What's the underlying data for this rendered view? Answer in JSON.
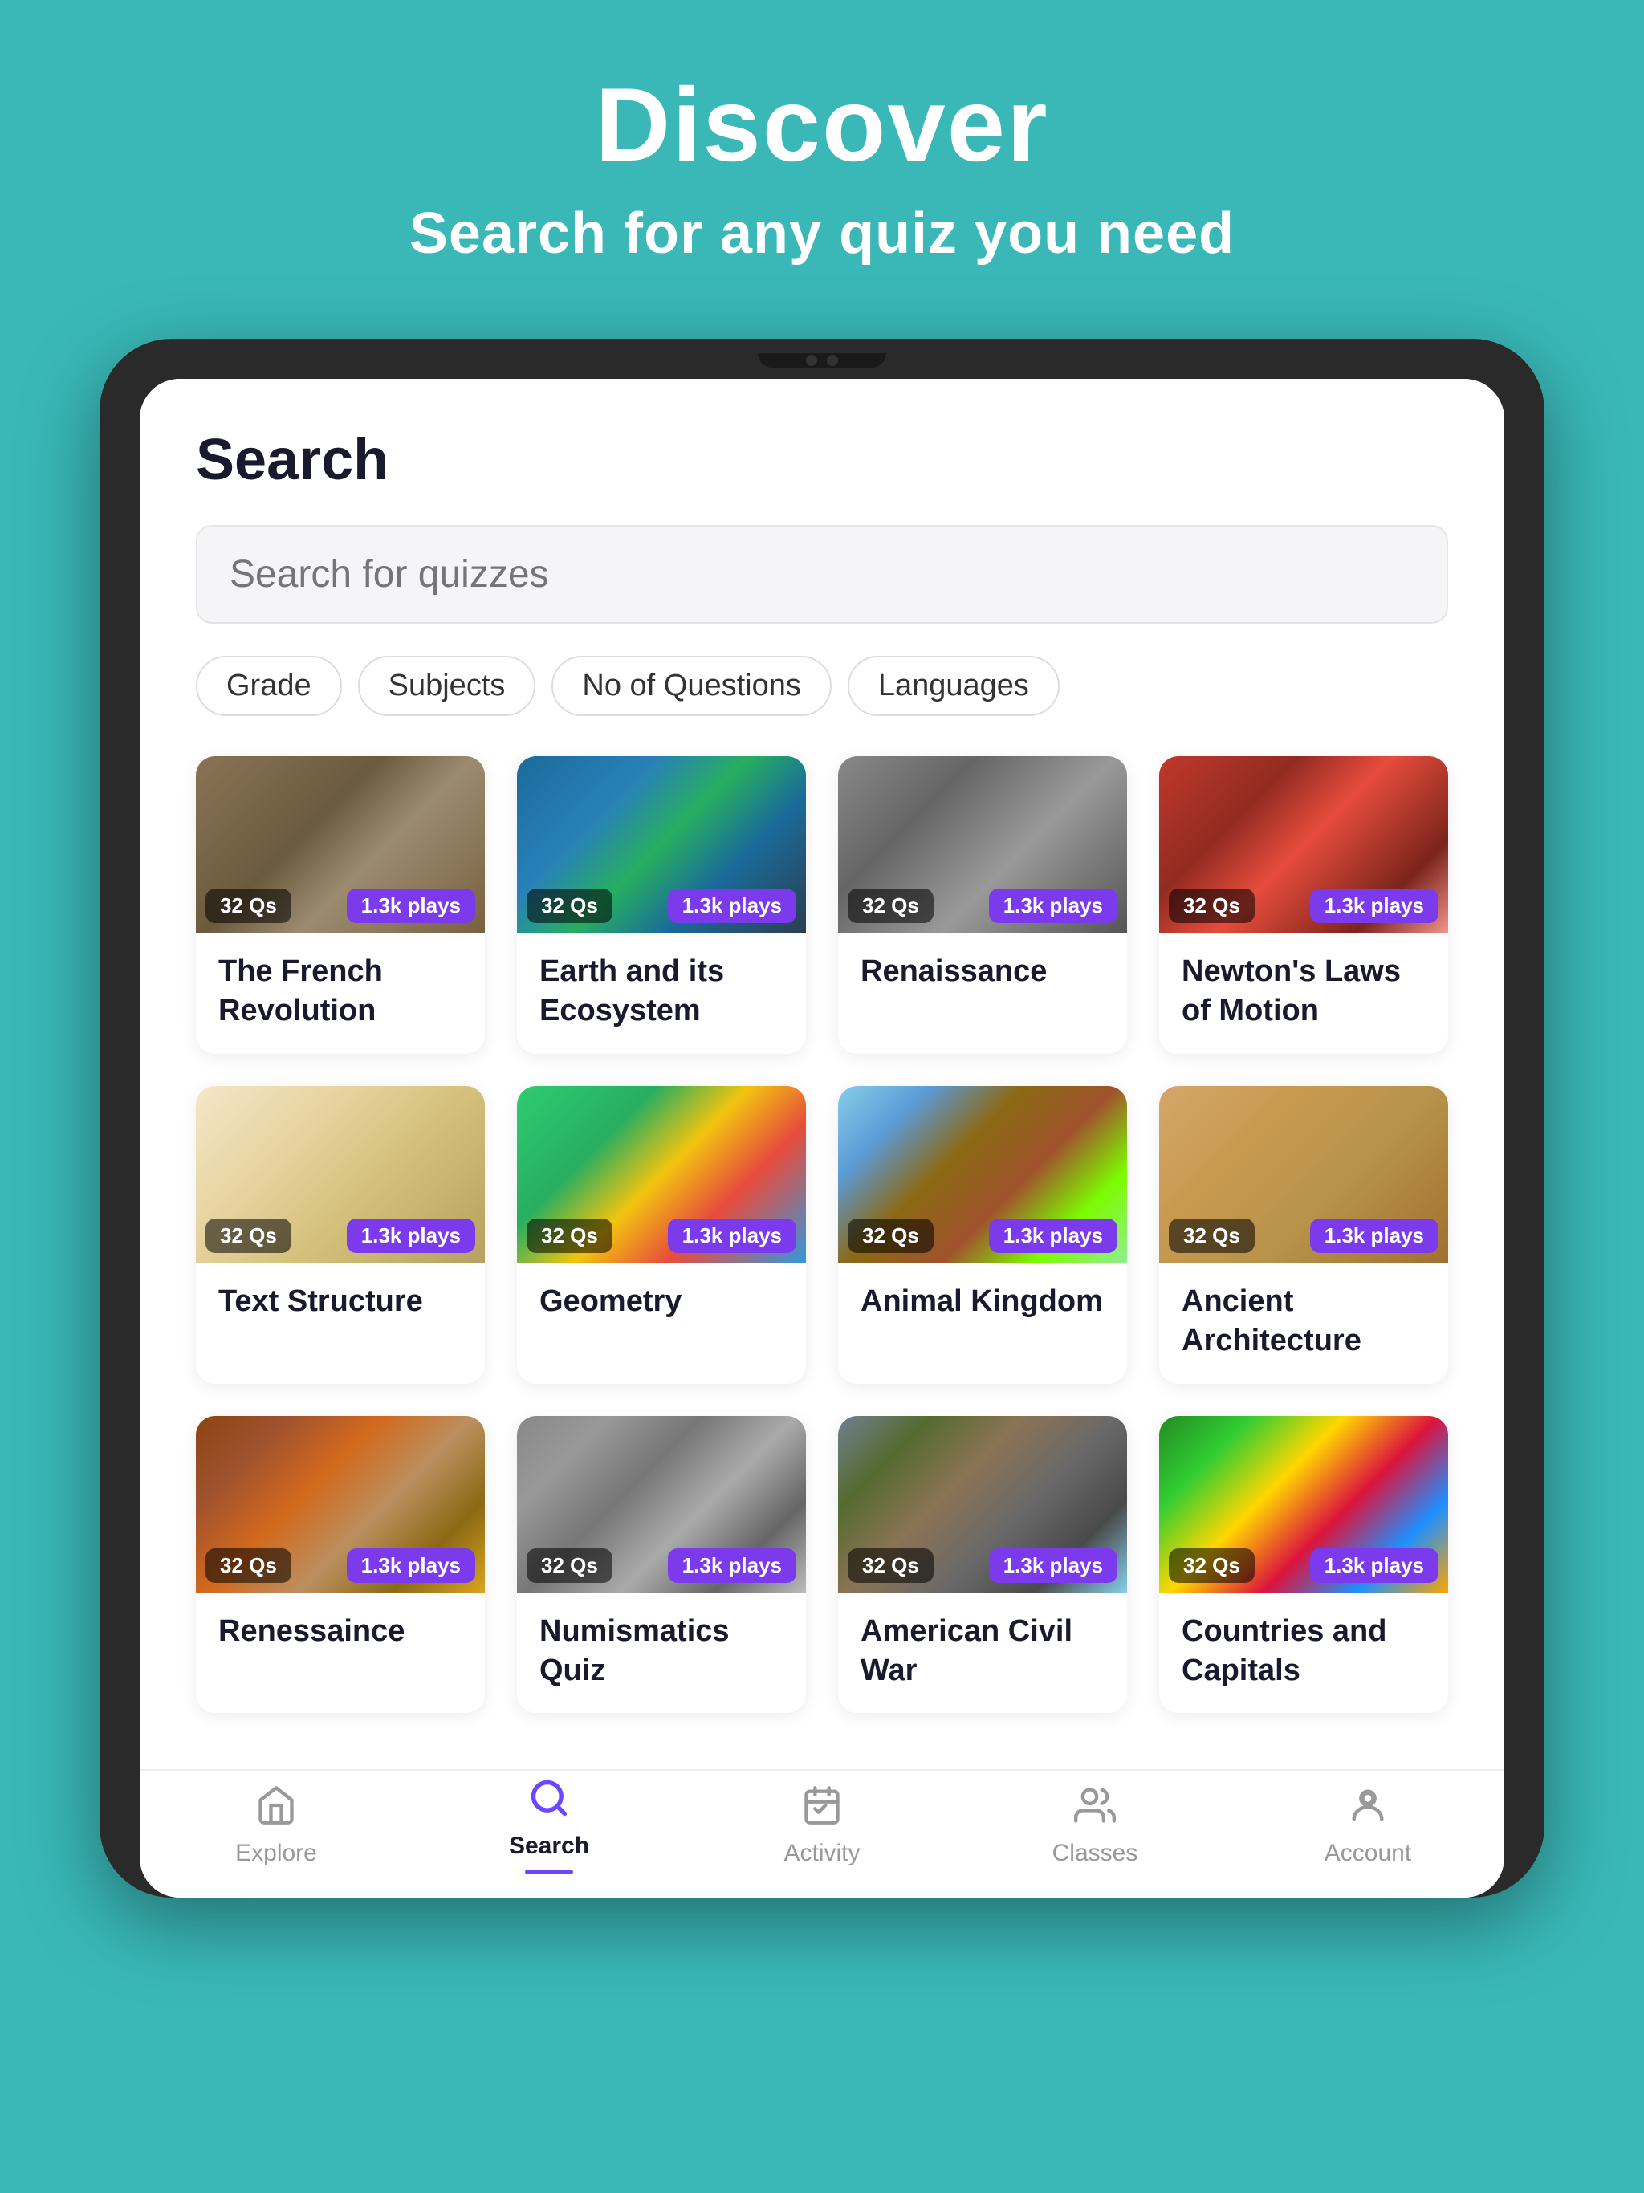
{
  "header": {
    "title": "Discover",
    "subtitle": "Search for any quiz you need"
  },
  "app": {
    "page_title": "Search",
    "search_placeholder": "Search for quizzes"
  },
  "filters": [
    {
      "label": "Grade"
    },
    {
      "label": "Subjects"
    },
    {
      "label": "No of Questions"
    },
    {
      "label": "Languages"
    }
  ],
  "quizzes": [
    {
      "title": "The French Revolution",
      "qs": "32 Qs",
      "plays": "1.3k plays",
      "img_class": "img-french"
    },
    {
      "title": "Earth and its Ecosystem",
      "qs": "32 Qs",
      "plays": "1.3k plays",
      "img_class": "img-earth"
    },
    {
      "title": "Renaissance",
      "qs": "32 Qs",
      "plays": "1.3k plays",
      "img_class": "img-renaissance"
    },
    {
      "title": "Newton's Laws of Motion",
      "qs": "32 Qs",
      "plays": "1.3k plays",
      "img_class": "img-newton"
    },
    {
      "title": "Text Structure",
      "qs": "32 Qs",
      "plays": "1.3k plays",
      "img_class": "img-text"
    },
    {
      "title": "Geometry",
      "qs": "32 Qs",
      "plays": "1.3k plays",
      "img_class": "img-geometry"
    },
    {
      "title": "Animal Kingdom",
      "qs": "32 Qs",
      "plays": "1.3k plays",
      "img_class": "img-animal"
    },
    {
      "title": "Ancient Architecture",
      "qs": "32 Qs",
      "plays": "1.3k plays",
      "img_class": "img-architecture"
    },
    {
      "title": "Renessaince",
      "qs": "32 Qs",
      "plays": "1.3k plays",
      "img_class": "img-renaissance2"
    },
    {
      "title": "Numismatics Quiz",
      "qs": "32 Qs",
      "plays": "1.3k plays",
      "img_class": "img-numismatics"
    },
    {
      "title": "American Civil War",
      "qs": "32 Qs",
      "plays": "1.3k plays",
      "img_class": "img-civil-war"
    },
    {
      "title": "Countries and Capitals",
      "qs": "32 Qs",
      "plays": "1.3k plays",
      "img_class": "img-countries"
    }
  ],
  "nav": {
    "items": [
      {
        "label": "Explore",
        "icon": "home",
        "active": false
      },
      {
        "label": "Search",
        "icon": "search",
        "active": true
      },
      {
        "label": "Activity",
        "icon": "activity",
        "active": false
      },
      {
        "label": "Classes",
        "icon": "classes",
        "active": false
      },
      {
        "label": "Account",
        "icon": "account",
        "active": false
      }
    ]
  },
  "colors": {
    "teal": "#3ab8b8",
    "purple": "#6c47ff",
    "dark": "#1a1a2e"
  }
}
